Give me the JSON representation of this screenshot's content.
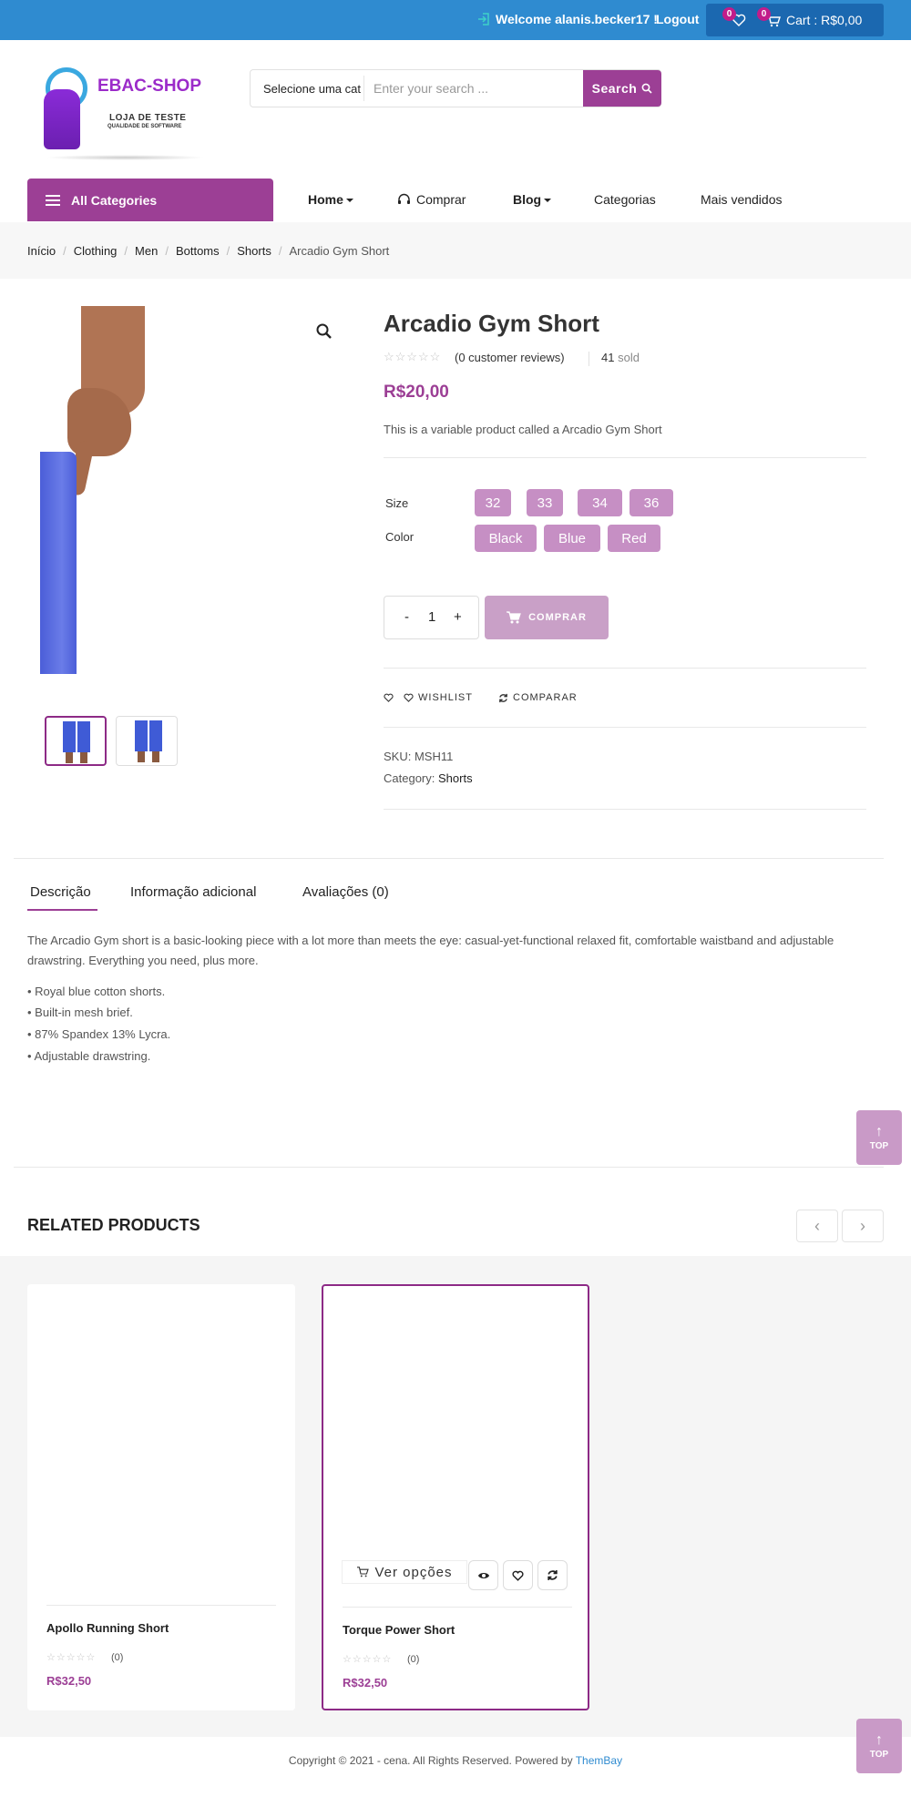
{
  "topbar": {
    "welcome": "Welcome alanis.becker17 !",
    "logout": "Logout",
    "wishlist_count": "0",
    "cart_count": "0",
    "cart_total": "Cart : R$0,00"
  },
  "logo": {
    "name": "EBAC-SHOP",
    "sub1": "LOJA DE TESTE",
    "sub2": "QUALIDADE DE SOFTWARE"
  },
  "search": {
    "category": "Selecione uma cat",
    "placeholder": "Enter your search ...",
    "button": "Search"
  },
  "nav": {
    "all_categories": "All Categories",
    "home": "Home",
    "comprar": "Comprar",
    "blog": "Blog",
    "categorias": "Categorias",
    "mais_vendidos": "Mais vendidos"
  },
  "breadcrumb": [
    "Início",
    "Clothing",
    "Men",
    "Bottoms",
    "Shorts",
    "Arcadio Gym Short"
  ],
  "product": {
    "title": "Arcadio Gym Short",
    "stars": "☆☆☆☆☆",
    "reviews": "(0 customer reviews)",
    "sold_count": "41",
    "sold_label": "sold",
    "price": "R$20,00",
    "short_description": "This is a variable product called a Arcadio Gym Short",
    "size_label": "Size",
    "sizes": [
      "32",
      "33",
      "34",
      "36"
    ],
    "color_label": "Color",
    "colors": [
      "Black",
      "Blue",
      "Red"
    ],
    "qty_minus": "-",
    "qty_value": "1",
    "qty_plus": "+",
    "buy_button": "COMPRAR",
    "wishlist": "WISHLIST",
    "compare": "COMPARAR",
    "sku_label": "SKU:",
    "sku": "MSH11",
    "category_label": "Category:",
    "category": "Shorts"
  },
  "tabs": {
    "descricao": "Descrição",
    "info": "Informação adicional",
    "avaliacoes": "Avaliações (0)"
  },
  "description": {
    "paragraph": "The Arcadio Gym short is a basic-looking piece with a lot more than meets the eye: casual-yet-functional relaxed fit, comfortable waistband and adjustable drawstring. Everything you need, plus more.",
    "bullets": [
      "• Royal blue cotton shorts.",
      "• Built-in mesh brief.",
      "• 87% Spandex 13% Lycra.",
      "• Adjustable drawstring."
    ]
  },
  "top_button": "TOP",
  "related": {
    "title": "RELATED PRODUCTS",
    "prev": "‹",
    "next": "›",
    "products": [
      {
        "name": "Apollo Running Short",
        "stars": "☆☆☆☆☆",
        "review_count": "(0)",
        "price": "R$32,50"
      },
      {
        "name": "Torque Power Short",
        "stars": "☆☆☆☆☆",
        "review_count": "(0)",
        "price": "R$32,50",
        "options_button": "Ver opções"
      }
    ]
  },
  "footer": {
    "copyright": "Copyright © 2021 - cena. All Rights Reserved. Powered by ",
    "powered_by": "ThemBay"
  },
  "colors": {
    "brand_purple": "#9c3f95",
    "topbar_blue": "#2f8bd0",
    "swatch": "#c68fc4"
  }
}
